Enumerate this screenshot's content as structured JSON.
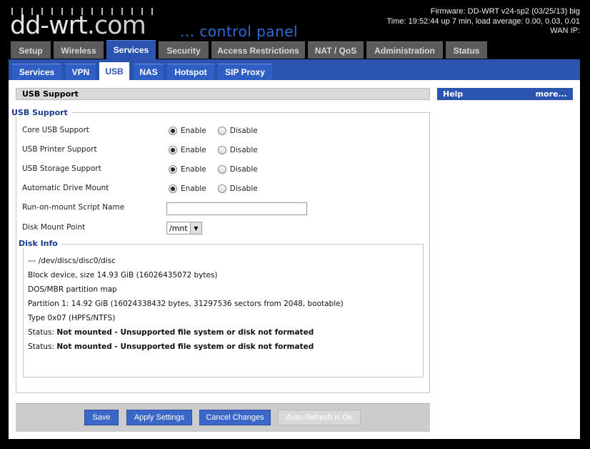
{
  "header": {
    "logo_main": "dd-wrt",
    "logo_tld": ".com",
    "subtitle": "... control panel",
    "firmware": "Firmware: DD-WRT v24-sp2 (03/25/13) big",
    "time": "Time: 19:52:44 up 7 min, load average: 0.00, 0.03, 0.01",
    "wan_ip": "WAN IP:"
  },
  "top_tabs": [
    {
      "label": "Setup"
    },
    {
      "label": "Wireless"
    },
    {
      "label": "Services",
      "active": true
    },
    {
      "label": "Security"
    },
    {
      "label": "Access Restrictions"
    },
    {
      "label": "NAT / QoS"
    },
    {
      "label": "Administration"
    },
    {
      "label": "Status"
    }
  ],
  "sub_tabs": [
    {
      "label": "Services"
    },
    {
      "label": "VPN"
    },
    {
      "label": "USB",
      "active": true
    },
    {
      "label": "NAS"
    },
    {
      "label": "Hotspot"
    },
    {
      "label": "SIP Proxy"
    }
  ],
  "page_title": "USB Support",
  "usb_section": {
    "legend": "USB Support",
    "enable_label": "Enable",
    "disable_label": "Disable",
    "rows": [
      {
        "label": "Core USB Support",
        "value": "Enable"
      },
      {
        "label": "USB Printer Support",
        "value": "Enable"
      },
      {
        "label": "USB Storage Support",
        "value": "Enable"
      },
      {
        "label": "Automatic Drive Mount",
        "value": "Enable"
      }
    ],
    "script_label": "Run-on-mount Script Name",
    "script_value": "",
    "mount_label": "Disk Mount Point",
    "mount_value": "/mnt"
  },
  "disk_info": {
    "legend": "Disk Info",
    "lines": [
      "--- /dev/discs/disc0/disc",
      "Block device, size 14.93 GiB (16026435072 bytes)",
      "DOS/MBR partition map",
      "Partition 1: 14.92 GiB (16024338432 bytes, 31297536 sectors from 2048, bootable)",
      "Type 0x07 (HPFS/NTFS)"
    ],
    "status_prefix": "Status: ",
    "status_lines": [
      "Not mounted - Unsupported file system or disk not formated",
      "Not mounted - Unsupported file system or disk not formated"
    ]
  },
  "help": {
    "title": "Help",
    "more": "more..."
  },
  "buttons": {
    "save": "Save",
    "apply": "Apply Settings",
    "cancel": "Cancel Changes",
    "autorefresh": "Auto-Refresh is On"
  },
  "colors": {
    "accent": "#2b54b0",
    "legend": "#1b3c8c",
    "cp_text": "#2f6bd9"
  }
}
